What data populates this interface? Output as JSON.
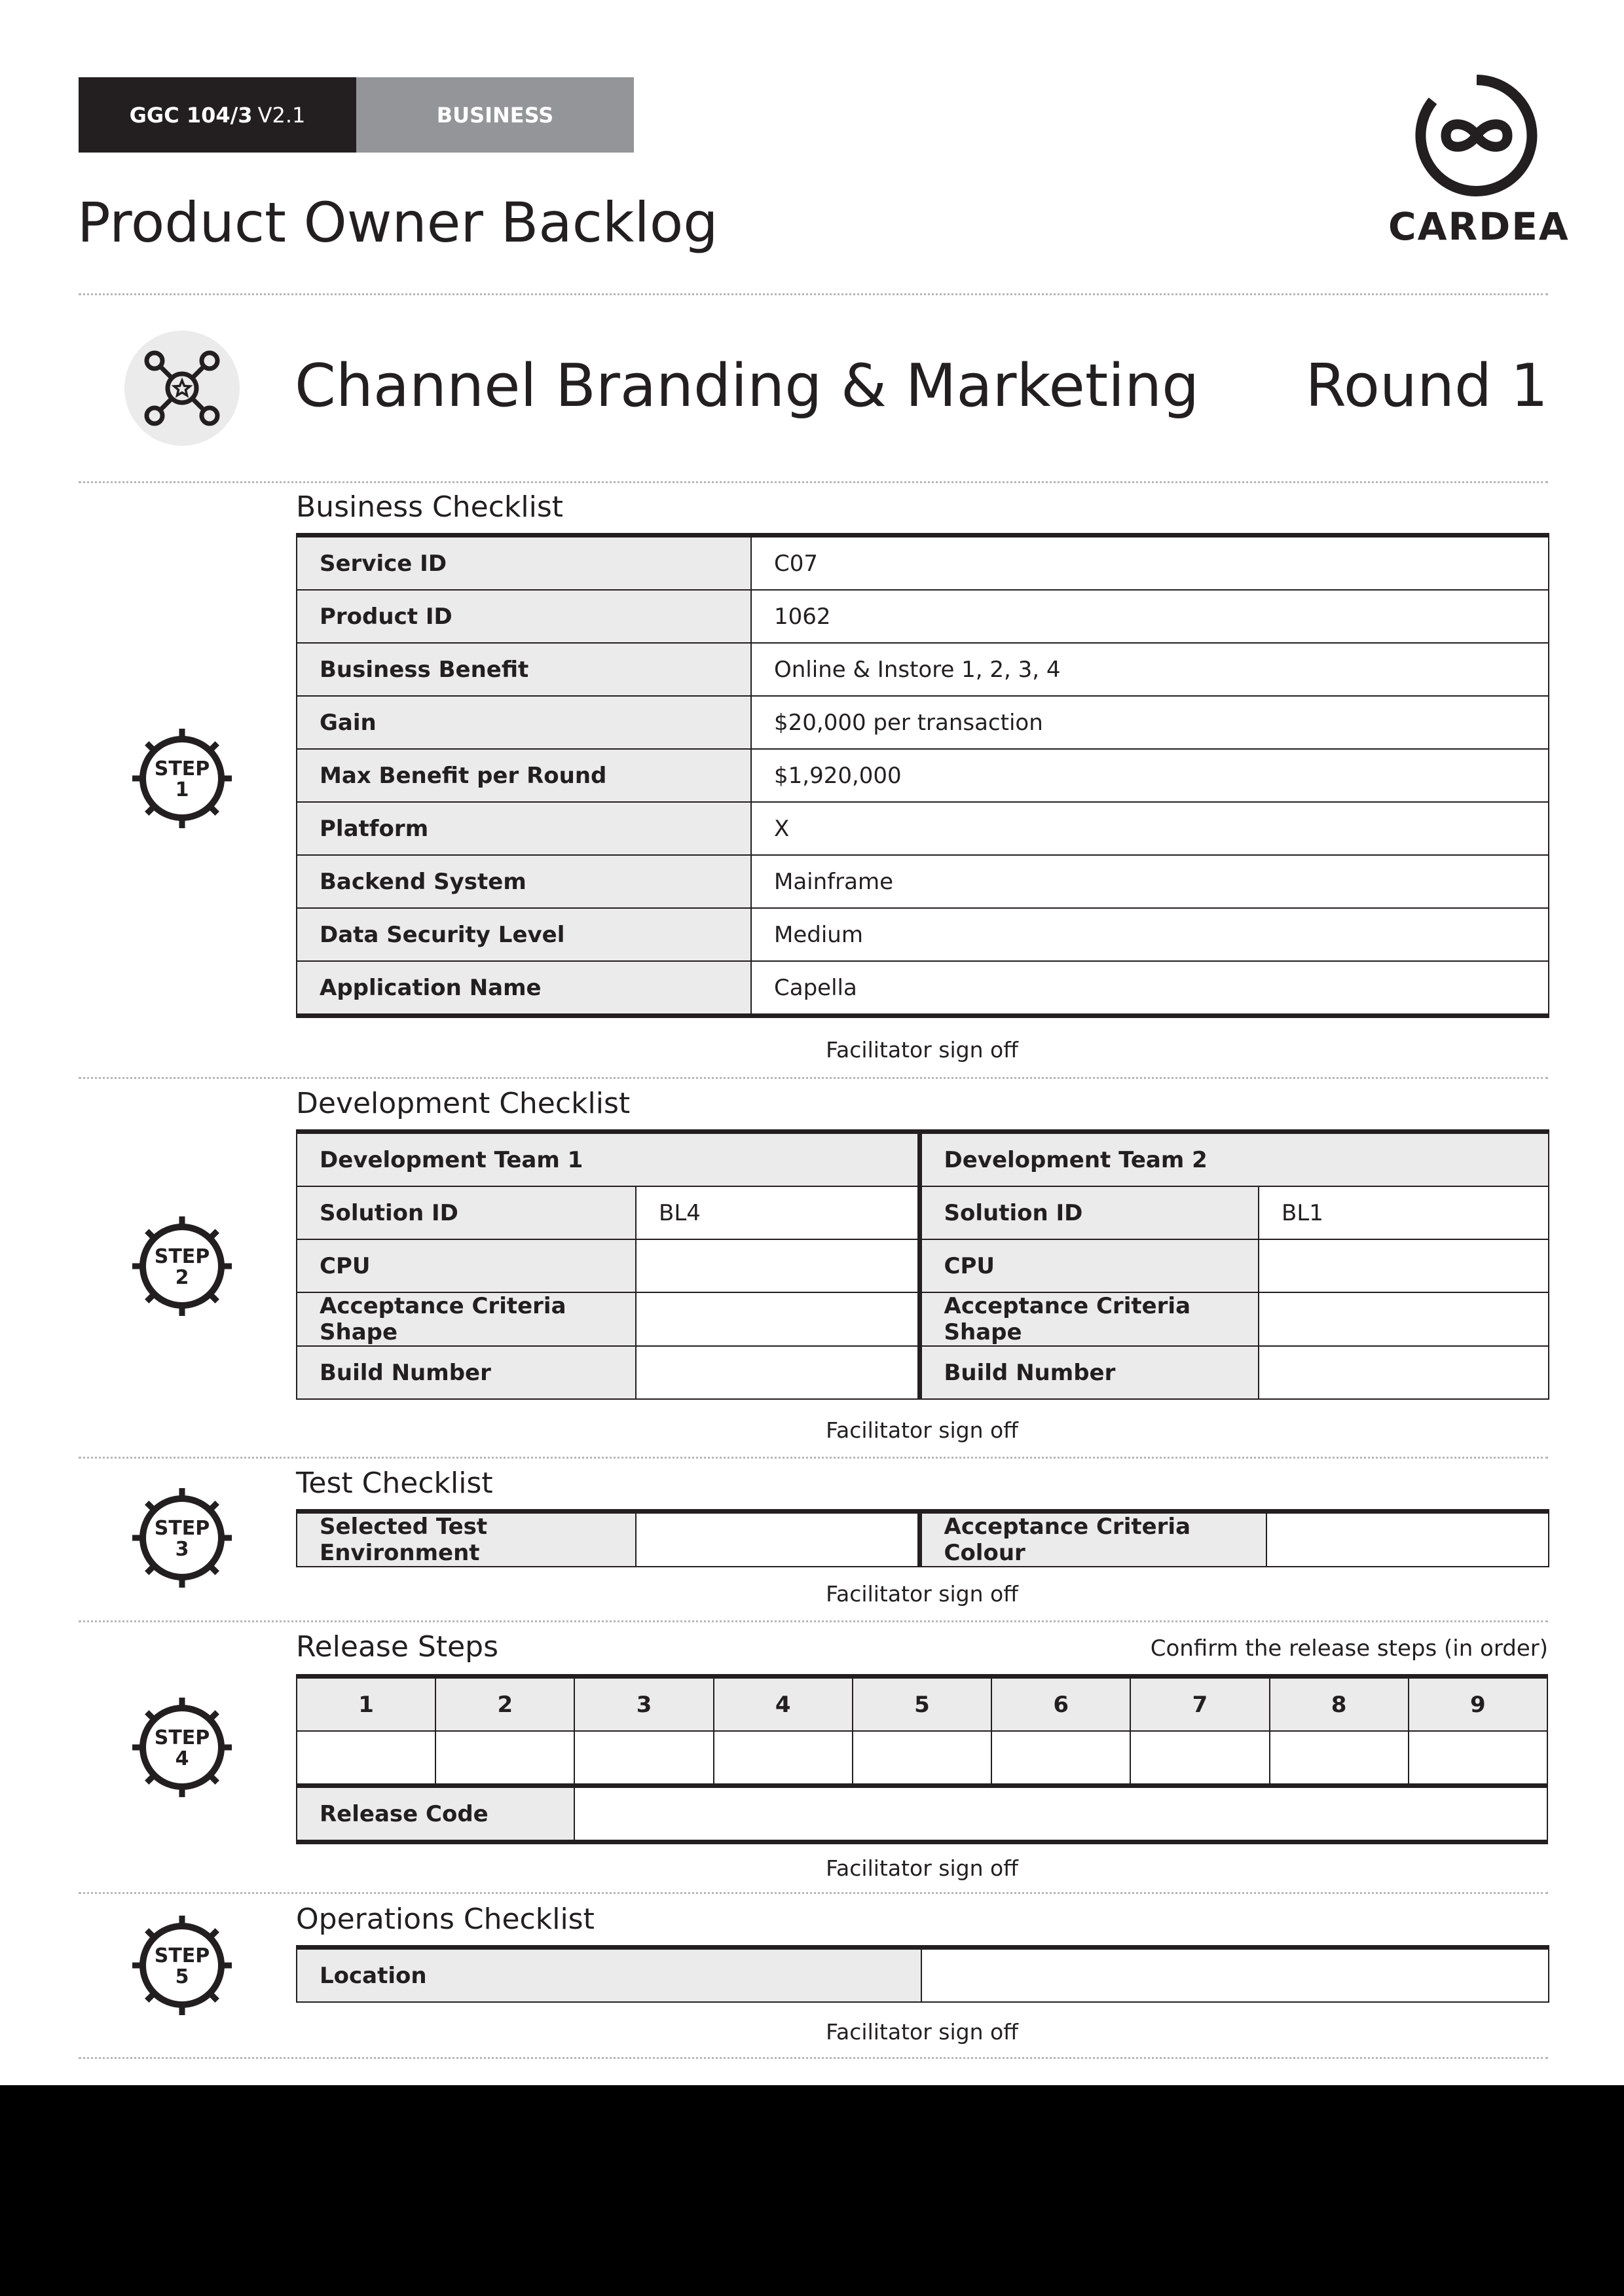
{
  "header": {
    "code_bold": "GGC 104/3",
    "code_version": "V2.1",
    "category": "BUSINESS",
    "doc_title": "Product Owner Backlog",
    "brand": "CARDEA"
  },
  "card": {
    "title": "Channel Branding & Marketing",
    "round": "Round 1",
    "icon": "network-star-icon"
  },
  "business": {
    "title": "Business Checklist",
    "rows": [
      {
        "label": "Service ID",
        "value": "C07"
      },
      {
        "label": "Product ID",
        "value": "1062"
      },
      {
        "label": "Business Benefit",
        "value": "Online & Instore 1, 2, 3, 4"
      },
      {
        "label": "Gain",
        "value": "$20,000 per transaction"
      },
      {
        "label": "Max Benefit per Round",
        "value": "$1,920,000"
      },
      {
        "label": "Platform",
        "value": "X"
      },
      {
        "label": "Backend System",
        "value": "Mainframe"
      },
      {
        "label": "Data Security Level",
        "value": "Medium"
      },
      {
        "label": "Application Name",
        "value": "Capella"
      }
    ],
    "signoff": "Facilitator sign off"
  },
  "development": {
    "title": "Development Checklist",
    "team1": "Development Team 1",
    "team2": "Development Team 2",
    "rows": [
      {
        "label": "Solution ID",
        "t1": "BL4",
        "t2": "BL1"
      },
      {
        "label": "CPU",
        "t1": "",
        "t2": ""
      },
      {
        "label": "Acceptance Criteria Shape",
        "t1": "",
        "t2": ""
      },
      {
        "label": "Build Number",
        "t1": "",
        "t2": ""
      }
    ],
    "signoff": "Facilitator sign off"
  },
  "test": {
    "title": "Test Checklist",
    "env_label": "Selected Test Environment",
    "colour_label": "Acceptance Criteria Colour",
    "signoff": "Facilitator sign off"
  },
  "release": {
    "title": "Release Steps",
    "hint": "Confirm the release steps (in order)",
    "steps": [
      "1",
      "2",
      "3",
      "4",
      "5",
      "6",
      "7",
      "8",
      "9"
    ],
    "code_label": "Release Code",
    "signoff": "Facilitator sign off"
  },
  "operations": {
    "title": "Operations Checklist",
    "location_label": "Location",
    "signoff": "Facilitator sign off"
  },
  "steps": {
    "word": "STEP",
    "numbers": [
      "1",
      "2",
      "3",
      "4",
      "5"
    ]
  }
}
